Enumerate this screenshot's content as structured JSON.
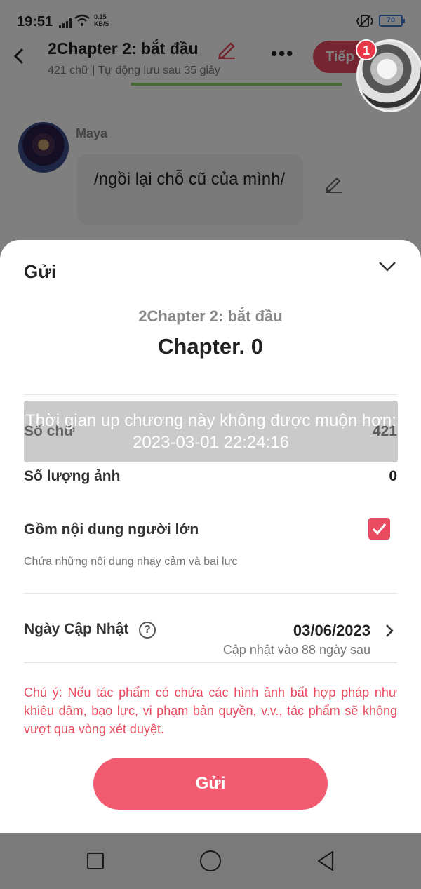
{
  "status_bar": {
    "time": "19:51",
    "net_speed_value": "0.15",
    "net_speed_unit": "KB/S",
    "battery": "70"
  },
  "editor": {
    "title": "2Chapter 2: bắt đầu",
    "subtitle": "421 chữ | Tự động lưu sau 35 giây",
    "next_button": "Tiếp",
    "notification_count": "1",
    "message": {
      "author": "Maya",
      "text": "/ngồi lại chỗ cũ của mình/"
    }
  },
  "sheet": {
    "title": "Gửi",
    "chapter_name": "2Chapter 2: bắt đầu",
    "chapter_number": "Chapter. 0",
    "word_count_label": "Số chữ",
    "word_count_value": "421",
    "image_count_label": "Số lượng ảnh",
    "image_count_value": "0",
    "toast": "Thời gian up chương này không được muộn hơn: 2023-03-01 22:24:16",
    "adult_label": "Gồm nội dung người lớn",
    "adult_checked": true,
    "adult_desc": "Chứa những nội dung nhạy cảm và bại lực",
    "update_label": "Ngày Cập Nhật",
    "update_date": "03/06/2023",
    "update_note": "Cập nhật vào 88 ngày sau",
    "warning": "Chú ý: Nếu tác phẩm có chứa các hình ảnh bất hợp pháp như khiêu dâm, bạo lực, vi phạm bản quyền, v.v., tác phẩm sẽ không vượt qua vòng xét duyệt.",
    "submit_label": "Gửi"
  },
  "colors": {
    "accent": "#f25a70",
    "warning": "#e84a5f",
    "overlay": "rgba(0,0,0,0.5)"
  }
}
